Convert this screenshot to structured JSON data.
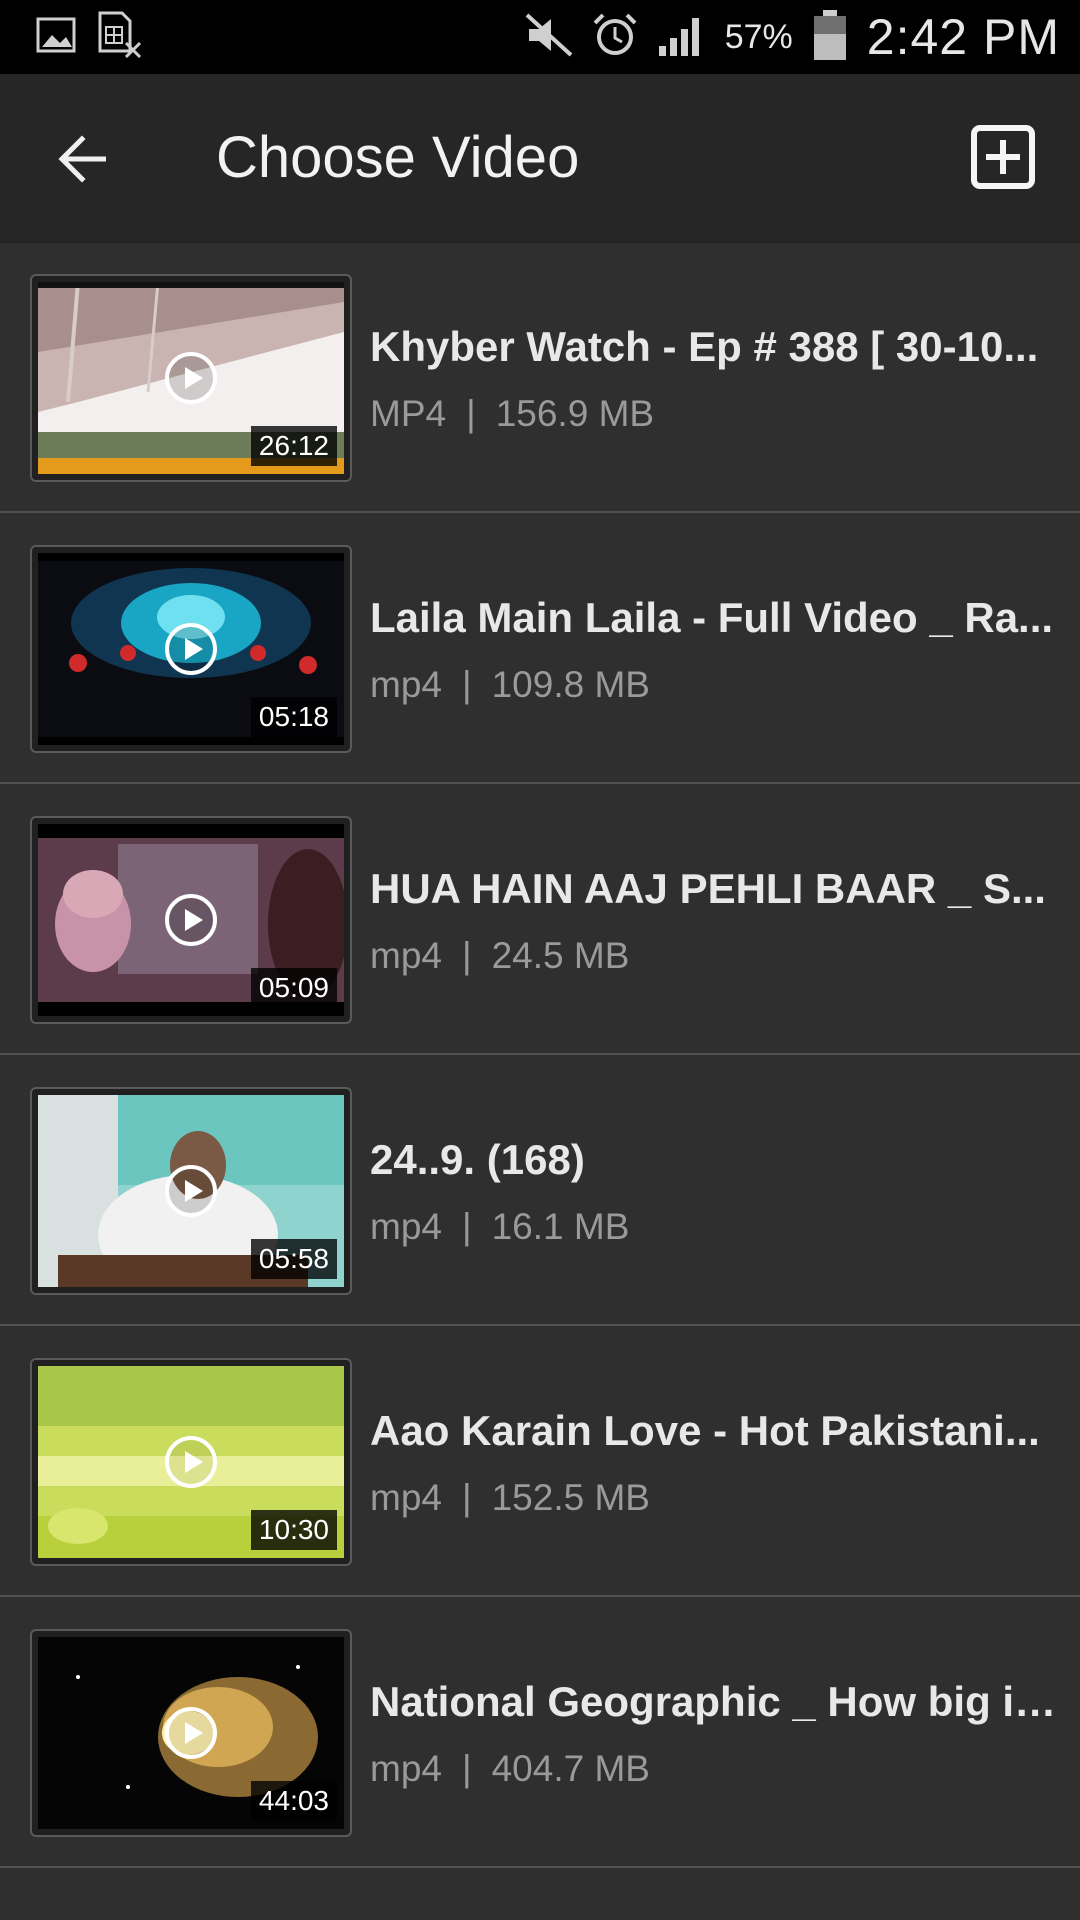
{
  "status_bar": {
    "battery_percent": "57%",
    "time": "2:42 PM",
    "left_icons": [
      "image-icon",
      "sim-off-icon"
    ],
    "right_icons": [
      "mute-icon",
      "alarm-icon",
      "signal-icon",
      "battery-icon"
    ]
  },
  "app_bar": {
    "title": "Choose Video",
    "back_icon": "arrow-left-icon",
    "add_icon": "add-box-icon"
  },
  "videos": [
    {
      "title": "Khyber Watch - Ep # 388 [ 30-10...",
      "format": "MP4",
      "size": "156.9 MB",
      "duration": "26:12"
    },
    {
      "title": "Laila Main Laila - Full Video _ Ra...",
      "format": "mp4",
      "size": "109.8 MB",
      "duration": "05:18"
    },
    {
      "title": "HUA HAIN AAJ PEHLI BAAR _ S...",
      "format": "mp4",
      "size": "24.5 MB",
      "duration": "05:09"
    },
    {
      "title": "24..9. (168)",
      "format": "mp4",
      "size": "16.1 MB",
      "duration": "05:58"
    },
    {
      "title": "Aao Karain Love - Hot Pakistani...",
      "format": "mp4",
      "size": "152.5 MB",
      "duration": "10:30"
    },
    {
      "title": "National Geographic _ How big is...",
      "format": "mp4",
      "size": "404.7 MB",
      "duration": "44:03"
    }
  ],
  "separator": "|",
  "colors": {
    "background": "#2f2f2f",
    "app_bar": "#262626",
    "status_bar": "#000000",
    "title_text": "#e8e8e8",
    "meta_text": "#9a9a9a"
  }
}
